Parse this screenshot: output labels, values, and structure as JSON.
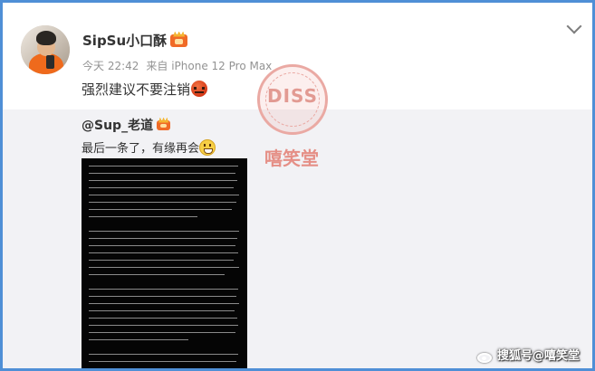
{
  "post": {
    "author": "SipSu小口酥",
    "time": "今天 22:42",
    "source": "来自 iPhone 12 Pro Max",
    "text": "强烈建议不要注销"
  },
  "repost": {
    "author": "@Sup_老道",
    "text": "最后一条了，有缘再会"
  },
  "watermark": {
    "logo": "DISS",
    "name": "嘻笑堂"
  },
  "corner_watermark": "搜狐号@嘻笑堂",
  "icons": {
    "menu": "chevron-down-icon",
    "vip": "vip-badge-icon",
    "angry_emoji": "angry-face-icon",
    "grin_emoji": "grin-face-icon",
    "weibo": "weibo-logo-icon"
  },
  "colors": {
    "frame_border": "#4f8fd6",
    "repost_bg": "#f2f2f5",
    "watermark": "#e58f86"
  }
}
